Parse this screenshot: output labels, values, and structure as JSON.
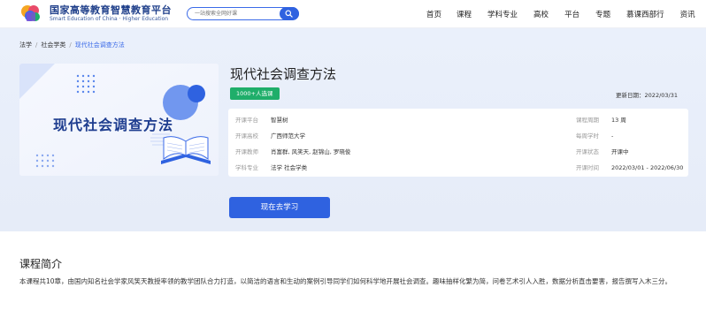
{
  "header": {
    "logo_cn": "国家高等教育智慧教育平台",
    "logo_en": "Smart Education of China · Higher Education",
    "search_placeholder": "一站搜索全网好课",
    "nav": [
      "首页",
      "课程",
      "学科专业",
      "高校",
      "平台",
      "专题",
      "慕课西部行",
      "资讯"
    ]
  },
  "breadcrumb": [
    "法学",
    "社会学类",
    "现代社会调查方法"
  ],
  "course": {
    "cover_title": "现代社会调查方法",
    "title": "现代社会调查方法",
    "badge": "1000+人选课",
    "update_label": "更新日期：",
    "update_date": "2022/03/31",
    "info_left": [
      {
        "label": "开课平台",
        "value": "智慧树"
      },
      {
        "label": "开课高校",
        "value": "广西师范大学"
      },
      {
        "label": "开课教师",
        "value": "肖富群, 风笑天, 赵锦山, 罗晓俊"
      },
      {
        "label": "学科专业",
        "value": "法学  社会学类"
      }
    ],
    "info_right": [
      {
        "label": "课程周期",
        "value": "13 周"
      },
      {
        "label": "每周学时",
        "value": "-"
      },
      {
        "label": "开课状态",
        "value": "开课中"
      },
      {
        "label": "开课时间",
        "value": "2022/03/01 - 2022/06/30"
      }
    ],
    "study_button": "现在去学习"
  },
  "intro": {
    "title": "课程简介",
    "text": "本课程共10章，由国内知名社会学家风笑天教授率领的教学团队合力打造，以简洁的语言和生动的案例引导同学们如何科学地开展社会调查。趣味抽样化繁为简，问卷艺术引人入胜，数据分析直击要害，报告撰写入木三分。"
  },
  "colors": {
    "primary": "#2f62e0",
    "badge_green": "#1fae6a",
    "hero_bg": "#e8eefa",
    "brand_navy": "#1e3d8f"
  }
}
